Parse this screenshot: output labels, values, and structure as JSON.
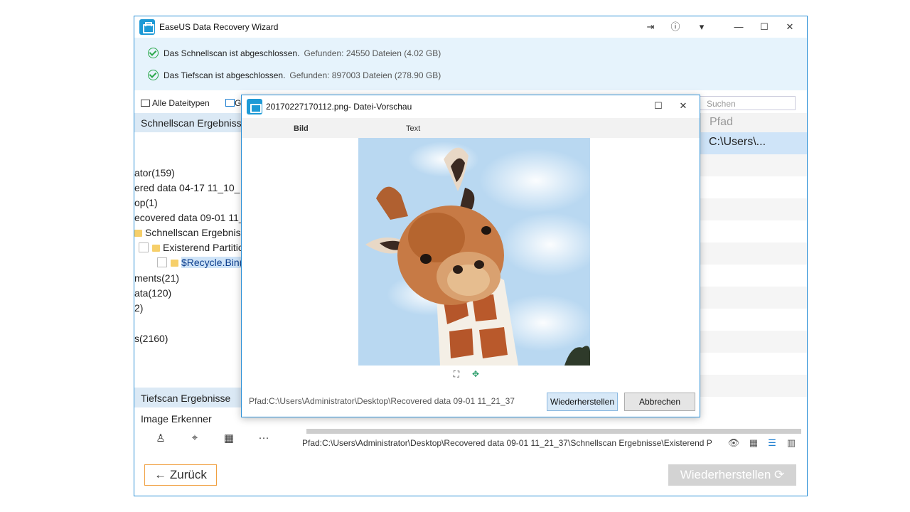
{
  "window": {
    "title": "EaseUS Data Recovery Wizard",
    "controls": [
      "sign-out-icon",
      "help-icon",
      "dropdown-icon",
      "minimize-icon",
      "maximize-icon",
      "close-icon"
    ]
  },
  "status": {
    "quick_scan": {
      "text": "Das Schnellscan ist abgeschlossen.",
      "found": "Gefunden: 24550 Dateien (4.02 GB)"
    },
    "deep_scan": {
      "text": "Das Tiefscan ist abgeschlossen.",
      "found": "Gefunden: 897003 Dateien (278.90 GB)"
    }
  },
  "filter": {
    "all_types": "Alle Dateitypen",
    "graphics_partial": "G",
    "search_placeholder": "Suchen"
  },
  "left_panel": {
    "header": "Schnellscan Ergebnisse",
    "tree": [
      "ator(159)",
      "ered data 04-17 11_10_",
      "op(1)",
      "ecovered data 09-01 11_",
      "Schnellscan Ergebniss",
      "Existerend Partitio",
      "$Recycle.Bin(",
      "ments(21)",
      "ata(120)",
      "2)",
      "s(2160)"
    ],
    "deep_scan_header": "Tiefscan Ergebnisse",
    "image_recognizer": "Image Erkenner",
    "recognizer_icons": [
      "person-icon",
      "animal-icon",
      "building-icon",
      "more-icon"
    ]
  },
  "right_panel": {
    "column_path": "Pfad",
    "selected_row_path": "C:\\Users\\..."
  },
  "bottom": {
    "path": "Pfad:C:\\Users\\Administrator\\Desktop\\Recovered data 09-01 11_21_37\\Schnellscan Ergebnisse\\Existerend P",
    "view_icons": [
      "eye-icon",
      "grid-icon",
      "list-icon",
      "detail-icon"
    ],
    "back_label": "← Zurück",
    "restore_label": "Wiederherstellen ⟳"
  },
  "preview_dialog": {
    "title": "20170227170112.png- Datei-Vorschau",
    "tabs": [
      "Bild",
      "Text"
    ],
    "path": "Pfad:C:\\Users\\Administrator\\Desktop\\Recovered data 09-01 11_21_37",
    "restore_label": "Wiederherstellen",
    "cancel_label": "Abbrechen"
  },
  "colors": {
    "accent": "#2b8fd6",
    "status_bg": "#e6f3fc",
    "selection": "#cfe4f8",
    "check_green": "#2aa84a",
    "back_border": "#f0a040"
  }
}
